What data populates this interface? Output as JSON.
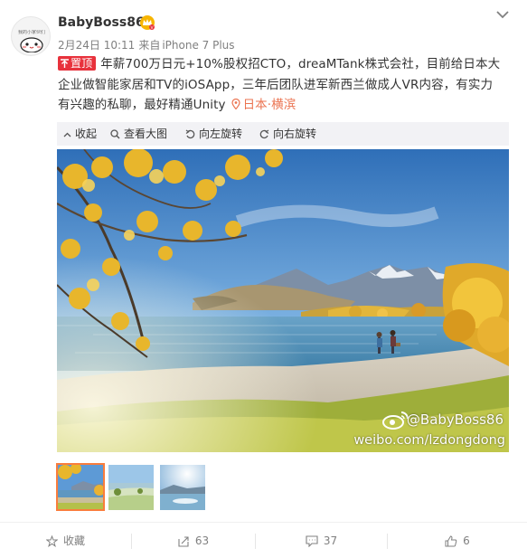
{
  "post": {
    "username": "BabyBoss86",
    "avatar_tag": "我的小家伙们",
    "time": "2月24日 10:11",
    "source_prefix": "来自",
    "source": "iPhone 7 Plus",
    "pin_label": "置顶",
    "text_line1": "年薪700万日元+10%股权招CTO，dreaMTank株式会社，目前给日本大",
    "text_line2": "企业做智能家居和TV的iOSApp，三年后团队进军新西兰做成人VR内容，有实力",
    "text_line3": "有兴趣的私聊，最好精通Unity",
    "location": "日本·横滨"
  },
  "toolbar": {
    "collapse": "收起",
    "view_large": "查看大图",
    "rotate_left": "向左旋转",
    "rotate_right": "向右旋转"
  },
  "photo": {
    "watermark_handle": "@BabyBoss86",
    "watermark_url": "weibo.com/lzdongdong"
  },
  "footer": {
    "favorite": "收藏",
    "reposts": "63",
    "comments": "37",
    "likes": "6"
  },
  "colors": {
    "accent": "#eb7350",
    "pin": "#e8323c",
    "selected_thumb_border": "#fa7d3c",
    "toolbar_bg": "#f2f2f5"
  },
  "icons": [
    "avatar",
    "vip-crown-icon",
    "chevron-down-icon",
    "location-pin-icon",
    "collapse-icon",
    "search-icon",
    "rotate-left-icon",
    "rotate-right-icon",
    "weibo-logo-icon",
    "star-icon",
    "repost-icon",
    "comment-icon",
    "thumbs-up-icon"
  ]
}
